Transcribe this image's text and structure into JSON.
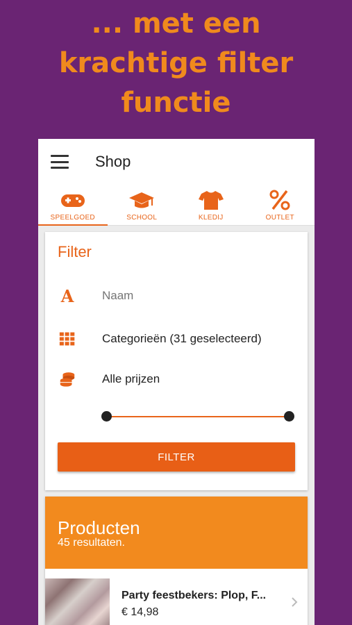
{
  "headline": [
    "... met een",
    "krachtige filter",
    "functie"
  ],
  "appbar": {
    "title": "Shop"
  },
  "tabs": [
    {
      "label": "SPEELGOED",
      "icon": "gamepad-icon",
      "active": true
    },
    {
      "label": "SCHOOL",
      "icon": "graduation-cap-icon",
      "active": false
    },
    {
      "label": "KLEDIJ",
      "icon": "tshirt-icon",
      "active": false
    },
    {
      "label": "OUTLET",
      "icon": "percent-icon",
      "active": false
    }
  ],
  "filter": {
    "title": "Filter",
    "name_placeholder": "Naam",
    "categories": "Categorieën (31 geselecteerd)",
    "prices": "Alle prijzen",
    "button": "FILTER"
  },
  "products": {
    "title": "Producten",
    "count": "45 resultaten.",
    "items": [
      {
        "name": "Party feestbekers: Plop, F...",
        "price": "€ 14,98"
      }
    ]
  },
  "colors": {
    "background": "#6a2473",
    "accent": "#e8641a",
    "header_orange": "#f28a1e"
  }
}
